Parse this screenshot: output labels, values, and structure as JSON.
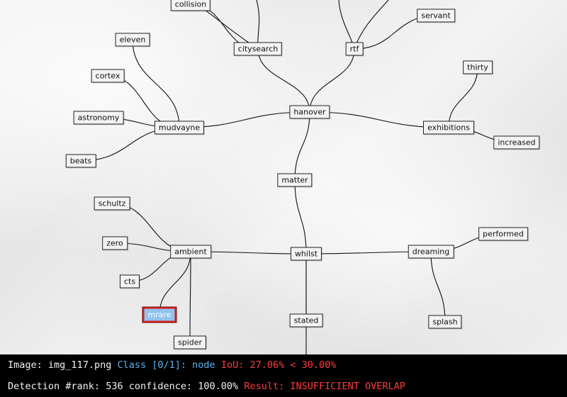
{
  "diagram": {
    "nodes": [
      {
        "id": "collision",
        "label": "collision"
      },
      {
        "id": "servant",
        "label": "servant"
      },
      {
        "id": "eleven",
        "label": "eleven"
      },
      {
        "id": "citysearch",
        "label": "citysearch"
      },
      {
        "id": "rtf",
        "label": "rtf"
      },
      {
        "id": "thirty",
        "label": "thirty"
      },
      {
        "id": "cortex",
        "label": "cortex"
      },
      {
        "id": "hanover",
        "label": "hanover"
      },
      {
        "id": "astronomy",
        "label": "astronomy"
      },
      {
        "id": "mudvayne",
        "label": "mudvayne"
      },
      {
        "id": "exhibitions",
        "label": "exhibitions"
      },
      {
        "id": "increased",
        "label": "increased"
      },
      {
        "id": "beats",
        "label": "beats"
      },
      {
        "id": "matter",
        "label": "matter"
      },
      {
        "id": "schultz",
        "label": "schultz"
      },
      {
        "id": "performed",
        "label": "performed"
      },
      {
        "id": "zero",
        "label": "zero"
      },
      {
        "id": "ambient",
        "label": "ambient"
      },
      {
        "id": "whilst",
        "label": "whilst"
      },
      {
        "id": "dreaming",
        "label": "dreaming"
      },
      {
        "id": "cts",
        "label": "cts"
      },
      {
        "id": "mrare",
        "label": "mrare",
        "highlighted": true
      },
      {
        "id": "stated",
        "label": "stated"
      },
      {
        "id": "splash",
        "label": "splash"
      },
      {
        "id": "spider",
        "label": "spider"
      }
    ],
    "edges": [
      [
        "collision",
        "citysearch"
      ],
      [
        "citysearch",
        "hanover"
      ],
      [
        "rtf",
        "hanover"
      ],
      [
        "servant",
        "rtf"
      ],
      [
        "eleven",
        "mudvayne"
      ],
      [
        "cortex",
        "mudvayne"
      ],
      [
        "astronomy",
        "mudvayne"
      ],
      [
        "beats",
        "mudvayne"
      ],
      [
        "mudvayne",
        "hanover"
      ],
      [
        "hanover",
        "exhibitions"
      ],
      [
        "exhibitions",
        "thirty"
      ],
      [
        "exhibitions",
        "increased"
      ],
      [
        "hanover",
        "matter"
      ],
      [
        "matter",
        "whilst"
      ],
      [
        "schultz",
        "ambient"
      ],
      [
        "zero",
        "ambient"
      ],
      [
        "cts",
        "ambient"
      ],
      [
        "ambient",
        "mrare"
      ],
      [
        "ambient",
        "spider"
      ],
      [
        "ambient",
        "whilst"
      ],
      [
        "whilst",
        "dreaming"
      ],
      [
        "dreaming",
        "performed"
      ],
      [
        "dreaming",
        "splash"
      ],
      [
        "whilst",
        "stated"
      ]
    ],
    "edge_color": "#111111",
    "highlight_fill": "#8ec4ee",
    "highlight_border": "#e01b1b"
  },
  "status": {
    "image_label": "Image:",
    "image_name": "img_117.png",
    "class_label": "Class [0/1]:",
    "class_value": "node",
    "iou_text": "IoU: 27.06% < 30.00%",
    "rank_label": "Detection #rank:",
    "rank_value": "536",
    "confidence_label": "confidence:",
    "confidence_value": "100.00%",
    "result_text": "Result: INSUFFICIENT OVERLAP",
    "colors": {
      "text": "#f2f2f2",
      "class": "#5ab0f0",
      "alert": "#ff3a3a",
      "background": "#000000"
    }
  }
}
